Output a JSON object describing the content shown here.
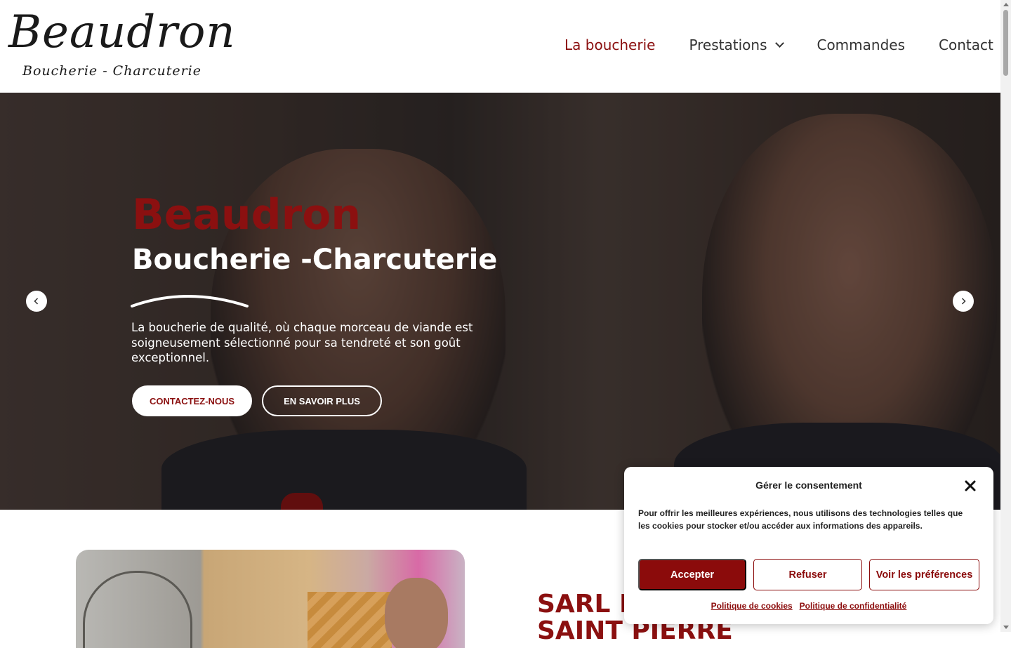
{
  "logo": {
    "main": "Beaudron",
    "sub": "Boucherie - Charcuterie"
  },
  "nav": {
    "items": [
      {
        "label": "La boucherie"
      },
      {
        "label": "Prestations"
      },
      {
        "label": "Commandes"
      },
      {
        "label": "Contact"
      }
    ]
  },
  "hero": {
    "title": "Beaudron",
    "subtitle": "Boucherie -Charcuterie",
    "description": "La boucherie de qualité, où chaque morceau de viande est soigneusement sélectionné pour sa tendreté et son goût exceptionnel.",
    "cta_primary": "CONTACTEZ-NOUS",
    "cta_secondary": "EN SAVOIR PLUS"
  },
  "section": {
    "title_line1": "SARL B",
    "title_line2": "SAINT PIERRE"
  },
  "cookie": {
    "title": "Gérer le consentement",
    "text": "Pour offrir les meilleures expériences, nous utilisons des technologies telles que les cookies pour stocker et/ou accéder aux informations des appareils.",
    "accept": "Accepter",
    "refuse": "Refuser",
    "preferences": "Voir les préférences",
    "cookie_policy": "Politique de cookies",
    "privacy_policy": "Politique de confidentialité"
  },
  "icons": {
    "dropdown": "chevron-down-icon",
    "prev": "chevron-left-icon",
    "next": "chevron-right-icon",
    "close": "close-icon"
  },
  "colors": {
    "brand": "#8b1010",
    "button": "#8b0b0b"
  }
}
